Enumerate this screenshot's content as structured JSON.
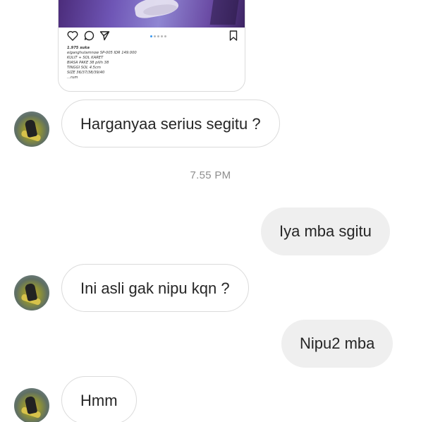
{
  "shared_post": {
    "likes": "1.975 suka",
    "caption_lines": [
      "eiganghutamnow SP-005 IDR 149.000",
      "KULIT + SOL KARET",
      "BIASA PAKE 38 pilih 38",
      "TINGGI SOL 4.5cm",
      "SIZE 36/37/38/39/40",
      "...rum"
    ]
  },
  "timestamp": "7.55 PM",
  "messages": [
    {
      "id": "m1",
      "direction": "incoming",
      "text": "Harganyaa serius segitu ?"
    },
    {
      "id": "m2",
      "direction": "outgoing",
      "text": "Iya mba sgitu"
    },
    {
      "id": "m3",
      "direction": "incoming",
      "text": "Ini asli gak nipu kqn ?"
    },
    {
      "id": "m4",
      "direction": "outgoing",
      "text": "Nipu2 mba"
    },
    {
      "id": "m5",
      "direction": "incoming",
      "text": "Hmm"
    }
  ],
  "icons": {
    "like": "heart-outline-icon",
    "comment": "comment-icon",
    "share": "direct-share-icon",
    "save": "bookmark-icon"
  }
}
